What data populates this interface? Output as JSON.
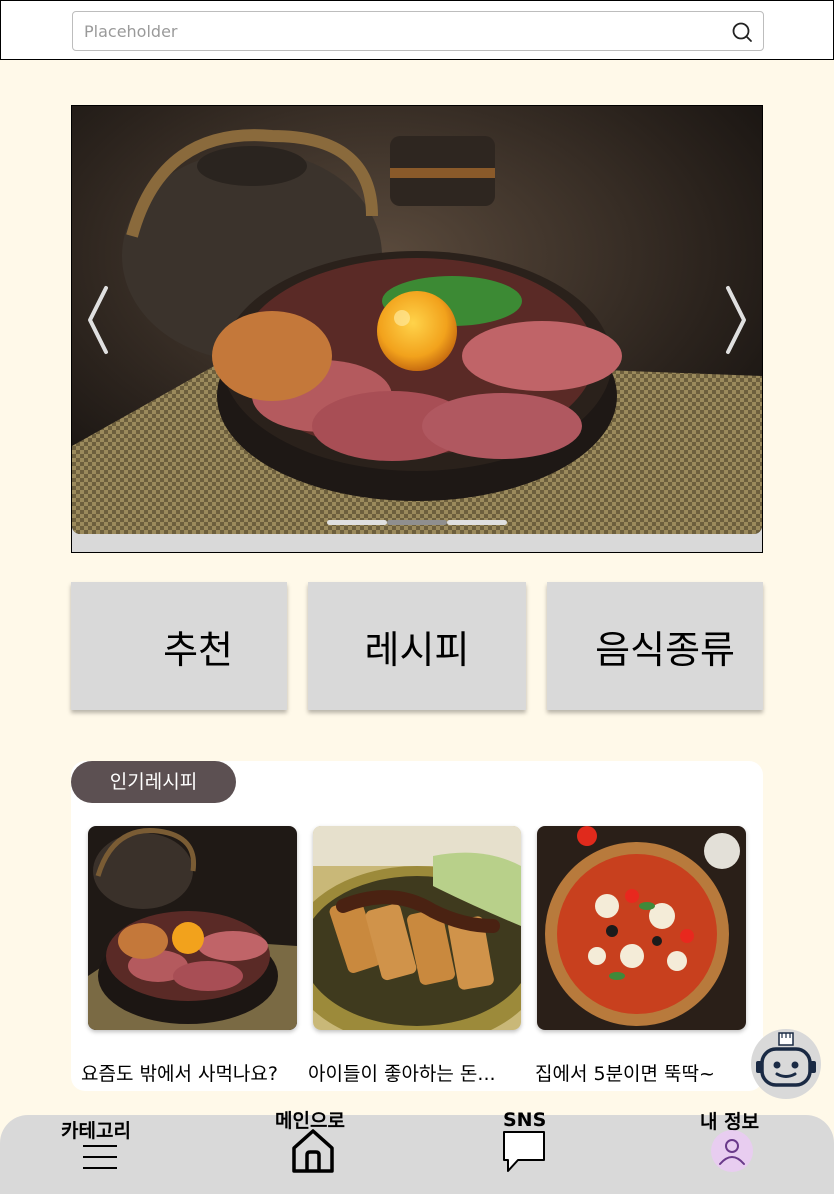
{
  "search": {
    "placeholder": "Placeholder"
  },
  "carousel": {
    "slide_count": 3,
    "active_index": 1
  },
  "categories": [
    {
      "label": "추천"
    },
    {
      "label": "레시피"
    },
    {
      "label": "음식종류"
    }
  ],
  "popular": {
    "title": "인기레시피",
    "cards": [
      {
        "caption": "요즘도 밖에서 사먹나요?"
      },
      {
        "caption": "아이들이 좋아하는 돈..."
      },
      {
        "caption": "집에서 5분이면 뚝딱~"
      }
    ]
  },
  "nav": {
    "category": "카테고리",
    "main": "메인으로",
    "sns": "SNS",
    "profile": "내 정보"
  },
  "colors": {
    "background": "#fff9e9",
    "pill": "#5c5052",
    "nav": "#d9d9d9",
    "avatar": "#e8cdf0"
  },
  "icons": [
    "search-icon",
    "chevron-left-icon",
    "chevron-right-icon",
    "robot-icon",
    "menu-icon",
    "home-icon",
    "chat-icon",
    "user-icon"
  ]
}
